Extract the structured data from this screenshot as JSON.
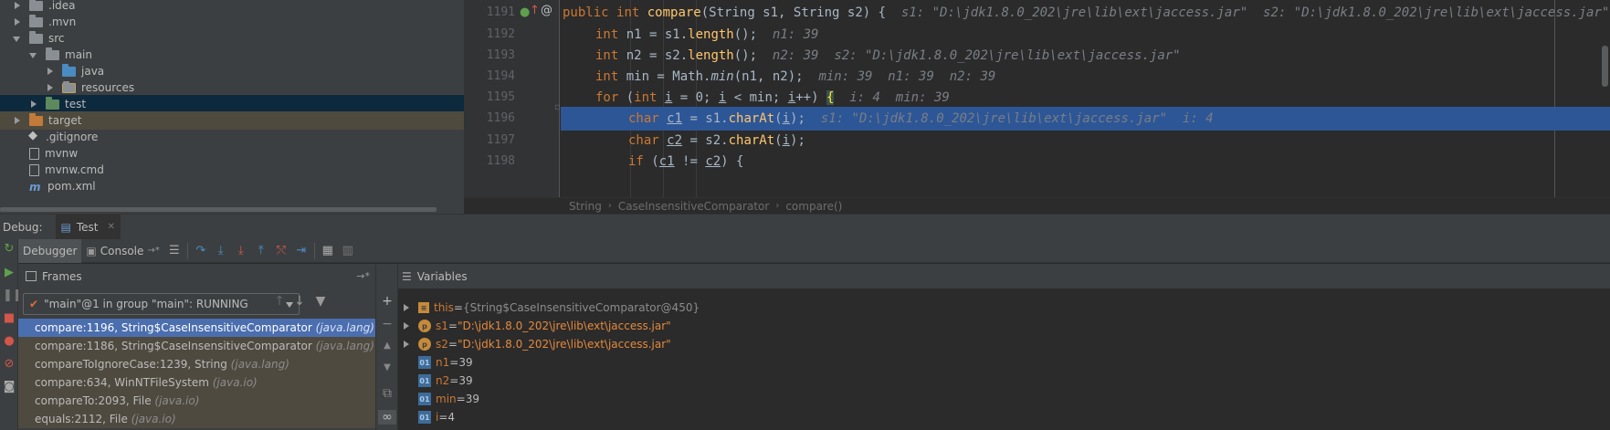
{
  "project_tree": {
    "items": [
      {
        "label": ".idea",
        "arrow": "right",
        "icon": "folder",
        "indent": 1
      },
      {
        "label": ".mvn",
        "arrow": "right",
        "icon": "folder",
        "indent": 1
      },
      {
        "label": "src",
        "arrow": "down",
        "icon": "folder",
        "indent": 1
      },
      {
        "label": "main",
        "arrow": "down",
        "icon": "folder",
        "indent": 2
      },
      {
        "label": "java",
        "arrow": "right",
        "icon": "folder-source",
        "indent": 3
      },
      {
        "label": "resources",
        "arrow": "right",
        "icon": "folder-resources",
        "indent": 3
      },
      {
        "label": "test",
        "arrow": "right",
        "icon": "folder-test",
        "indent": 2,
        "selected": true
      },
      {
        "label": "target",
        "arrow": "right",
        "icon": "folder-excluded",
        "indent": 1,
        "excluded": true
      },
      {
        "label": ".gitignore",
        "arrow": "none",
        "icon": "git-file",
        "indent": 1
      },
      {
        "label": "mvnw",
        "arrow": "none",
        "icon": "file",
        "indent": 1
      },
      {
        "label": "mvnw.cmd",
        "arrow": "none",
        "icon": "file",
        "indent": 1
      },
      {
        "label": "pom.xml",
        "arrow": "none",
        "icon": "maven-file",
        "indent": 1
      }
    ]
  },
  "editor": {
    "current_line": 1196,
    "lines": [
      {
        "number": "1191",
        "indent": 2,
        "segments": [
          [
            "kw",
            "public "
          ],
          [
            "kw",
            "int "
          ],
          [
            "fn",
            "compare"
          ],
          [
            "mc",
            "(String s1, String s2) {  "
          ],
          [
            "inl",
            "s1: \"D:\\jdk1.8.0_202\\jre\\lib\\ext\\jaccess.jar\"  s2: \"D:\\jdk1.8.0_202\\jre\\lib\\ext\\jaccess.jar\""
          ]
        ]
      },
      {
        "number": "1192",
        "indent": 3,
        "segments": [
          [
            "kw",
            "int "
          ],
          [
            "mc",
            "n1 = s1."
          ],
          [
            "fn2",
            "length"
          ],
          [
            "mc",
            "();  "
          ],
          [
            "inl",
            "n1: 39"
          ]
        ]
      },
      {
        "number": "1193",
        "indent": 3,
        "segments": [
          [
            "kw",
            "int "
          ],
          [
            "mc",
            "n2 = s2."
          ],
          [
            "fn2",
            "length"
          ],
          [
            "mc",
            "();  "
          ],
          [
            "inl",
            "n2: 39  s2: \"D:\\jdk1.8.0_202\\jre\\lib\\ext\\jaccess.jar\""
          ]
        ]
      },
      {
        "number": "1194",
        "indent": 3,
        "segments": [
          [
            "kw",
            "int "
          ],
          [
            "mc",
            "min = Math."
          ],
          [
            "it",
            "min"
          ],
          [
            "mc",
            "(n1, n2);  "
          ],
          [
            "inl",
            "min: 39  n1: 39  n2: 39"
          ]
        ]
      },
      {
        "number": "1195",
        "indent": 3,
        "segments": [
          [
            "kw",
            "for "
          ],
          [
            "mc",
            "("
          ],
          [
            "kw",
            "int "
          ],
          [
            "un",
            "i"
          ],
          [
            "mc",
            " = "
          ],
          [
            "mc",
            "0; "
          ],
          [
            "un",
            "i"
          ],
          [
            "mc",
            " < min; "
          ],
          [
            "un",
            "i"
          ],
          [
            "mc",
            "++) "
          ],
          [
            "brace",
            "{"
          ],
          [
            "mc",
            "  "
          ],
          [
            "inl",
            "i: 4  min: 39"
          ]
        ]
      },
      {
        "number": "1196",
        "indent": 4,
        "segments": [
          [
            "kw",
            "char "
          ],
          [
            "un",
            "c1"
          ],
          [
            "mc",
            " = s1."
          ],
          [
            "fn2",
            "charAt"
          ],
          [
            "mc",
            "("
          ],
          [
            "un",
            "i"
          ],
          [
            "mc",
            ");  "
          ],
          [
            "inl",
            "s1: \"D:\\jdk1.8.0_202\\jre\\lib\\ext\\jaccess.jar\"  i: 4"
          ]
        ]
      },
      {
        "number": "1197",
        "indent": 4,
        "segments": [
          [
            "kw",
            "char "
          ],
          [
            "un",
            "c2"
          ],
          [
            "mc",
            " = s2."
          ],
          [
            "fn2",
            "charAt"
          ],
          [
            "mc",
            "("
          ],
          [
            "un",
            "i"
          ],
          [
            "mc",
            ");"
          ]
        ]
      },
      {
        "number": "1198",
        "indent": 4,
        "segments": [
          [
            "kw",
            "if "
          ],
          [
            "mc",
            "("
          ],
          [
            "un",
            "c1"
          ],
          [
            "mc",
            " != "
          ],
          [
            "un",
            "c2"
          ],
          [
            "mc",
            ") {"
          ]
        ]
      }
    ]
  },
  "breadcrumb": [
    "String",
    "CaseInsensitiveComparator",
    "compare()"
  ],
  "debug_header": {
    "label": "Debug:",
    "tab": "Test"
  },
  "debug_toolbar": {
    "debugger_tab": "Debugger",
    "console_tab": "Console"
  },
  "frames": {
    "title": "Frames",
    "thread": "\"main\"@1 in group \"main\": RUNNING",
    "items": [
      {
        "method": "compare:1196, String$CaseInsensitiveComparator",
        "pkg": "(java.lang)",
        "selected": true
      },
      {
        "method": "compare:1186, String$CaseInsensitiveComparator",
        "pkg": "(java.lang)",
        "lib": true
      },
      {
        "method": "compareToIgnoreCase:1239, String",
        "pkg": "(java.lang)",
        "lib": true
      },
      {
        "method": "compare:634, WinNTFileSystem",
        "pkg": "(java.io)",
        "lib": true
      },
      {
        "method": "compareTo:2093, File",
        "pkg": "(java.io)",
        "lib": true
      },
      {
        "method": "equals:2112, File",
        "pkg": "(java.io)",
        "lib": true
      }
    ]
  },
  "variables": {
    "title": "Variables",
    "items": [
      {
        "name": "this",
        "eq": " = ",
        "value": "{String$CaseInsensitiveComparator@450}",
        "kind": "obj",
        "expandable": true
      },
      {
        "name": "s1",
        "eq": " = ",
        "value": "\"D:\\jdk1.8.0_202\\jre\\lib\\ext\\jaccess.jar\"",
        "kind": "param",
        "expandable": true
      },
      {
        "name": "s2",
        "eq": " = ",
        "value": "\"D:\\jdk1.8.0_202\\jre\\lib\\ext\\jaccess.jar\"",
        "kind": "param",
        "expandable": true
      },
      {
        "name": "n1",
        "eq": " = ",
        "value": "39",
        "kind": "prim",
        "expandable": false
      },
      {
        "name": "n2",
        "eq": " = ",
        "value": "39",
        "kind": "prim",
        "expandable": false
      },
      {
        "name": "min",
        "eq": " = ",
        "value": "39",
        "kind": "prim",
        "expandable": false
      },
      {
        "name": "i",
        "eq": " = ",
        "value": "4",
        "kind": "prim",
        "expandable": false
      }
    ]
  },
  "colors": {
    "selection": "#2d5696",
    "frame_selected": "#4b6eaf",
    "keyword": "#cc7832",
    "string": "#e5893b"
  }
}
